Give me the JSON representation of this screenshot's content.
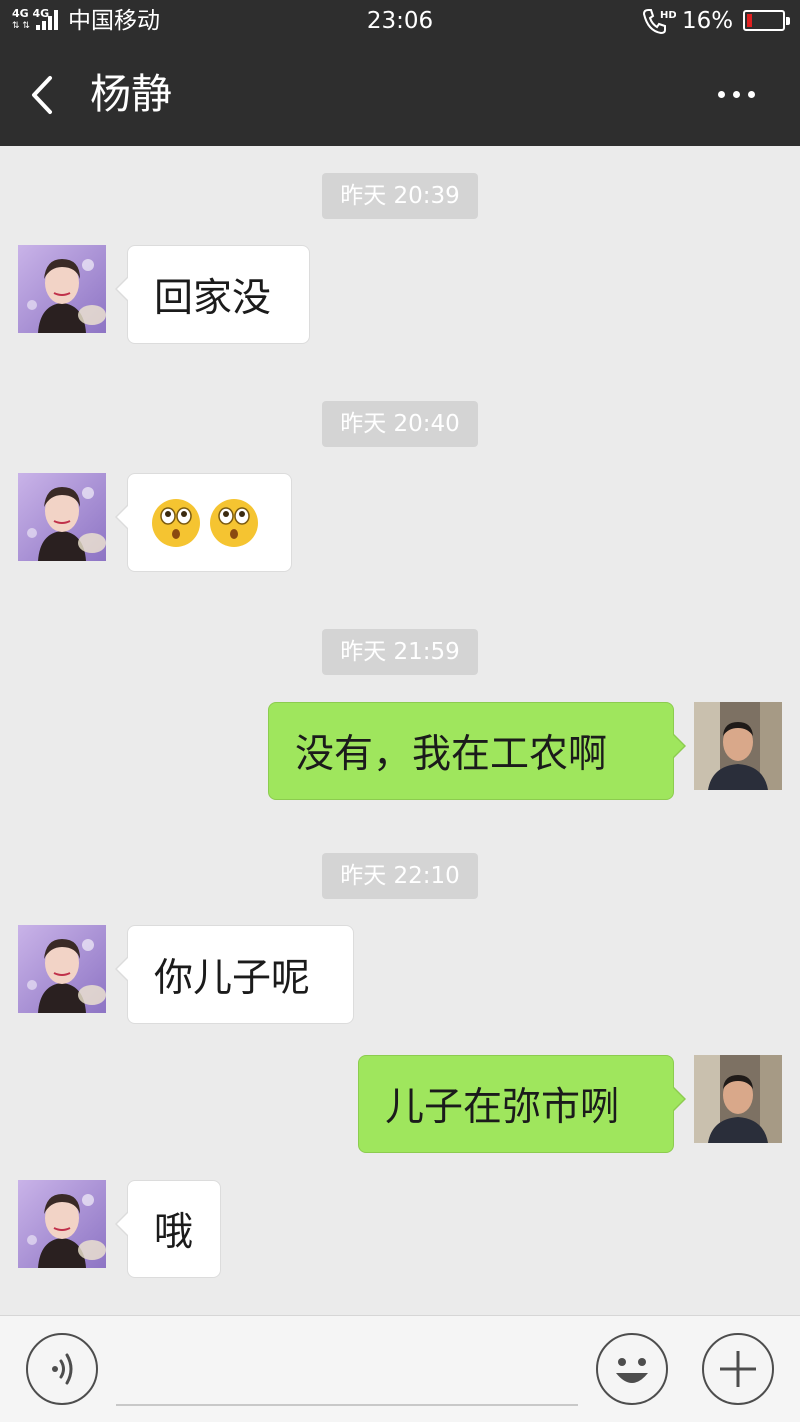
{
  "status_bar": {
    "network": "4G 4G",
    "carrier": "中国移动",
    "time": "23:06",
    "hd_badge": "HD",
    "battery_percent": "16%",
    "battery_level": 0.16,
    "battery_color": "#e02020"
  },
  "header": {
    "title": "杨静",
    "back_icon": "chevron-left-icon",
    "more_icon": "more-dots-icon"
  },
  "messages": [
    {
      "type": "timestamp",
      "text": "昨天 20:39"
    },
    {
      "type": "received",
      "text": "回家没"
    },
    {
      "type": "timestamp",
      "text": "昨天 20:40"
    },
    {
      "type": "received",
      "text": "",
      "emoji": [
        "flushed-emoji",
        "flushed-emoji"
      ]
    },
    {
      "type": "timestamp",
      "text": "昨天 21:59"
    },
    {
      "type": "sent",
      "text": "没有，我在工农啊"
    },
    {
      "type": "timestamp",
      "text": "昨天 22:10"
    },
    {
      "type": "received",
      "text": "你儿子呢"
    },
    {
      "type": "sent",
      "text": "儿子在弥市咧"
    },
    {
      "type": "received",
      "text": "哦"
    }
  ],
  "input_bar": {
    "voice_icon": "voice-icon",
    "text_value": "",
    "emoji_icon": "smiley-icon",
    "plus_icon": "plus-icon"
  },
  "colors": {
    "header_bg": "#2e2e2e",
    "chat_bg": "#ebebeb",
    "sent_bubble": "#9fe65d",
    "received_bubble": "#ffffff",
    "timestamp_bg": "#d4d4d4"
  }
}
